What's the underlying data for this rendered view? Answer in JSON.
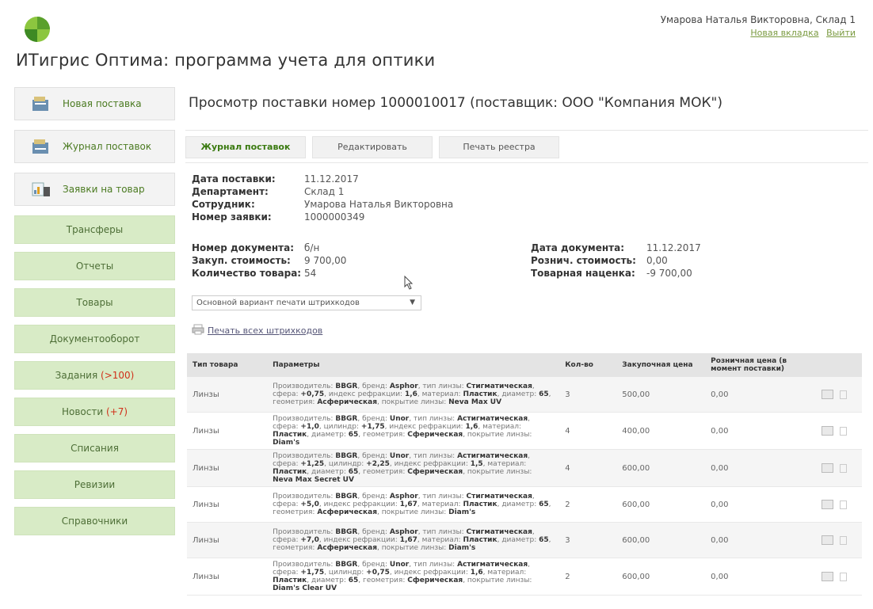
{
  "header": {
    "app_title": "ИТигрис Оптима: программа учета для оптики",
    "user_name": "Умарова Наталья Викторовна, Склад 1",
    "new_tab_link": "Новая вкладка",
    "logout_link": "Выйти"
  },
  "sidebar": {
    "items": [
      {
        "label": "Новая поставка",
        "icon": "new-delivery-icon"
      },
      {
        "label": "Журнал поставок",
        "icon": "delivery-log-icon"
      },
      {
        "label": "Заявки на товар",
        "icon": "product-requests-icon"
      },
      {
        "label": "Трансферы"
      },
      {
        "label": "Отчеты"
      },
      {
        "label": "Товары"
      },
      {
        "label": "Документооборот"
      },
      {
        "label": "Задания",
        "badge": "(>100)"
      },
      {
        "label": "Новости",
        "badge": "(+7)"
      },
      {
        "label": "Списания"
      },
      {
        "label": "Ревизии"
      },
      {
        "label": "Справочники"
      }
    ]
  },
  "main": {
    "title": "Просмотр поставки номер 1000010017 (поставщик: ООО \"Компания МОК\")",
    "tabs": [
      "Журнал поставок",
      "Редактировать",
      "Печать реестра"
    ],
    "details": [
      {
        "key": "Дата поставки:",
        "value": "11.12.2017"
      },
      {
        "key": "Департамент:",
        "value": "Склад 1"
      },
      {
        "key": "Сотрудник:",
        "value": "Умарова Наталья Викторовна"
      },
      {
        "key": "Номер заявки:",
        "value": "1000000349"
      }
    ],
    "doc_left": [
      {
        "key": "Номер документа:",
        "value": "б/н"
      },
      {
        "key": "Закуп. стоимость:",
        "value": "9 700,00"
      },
      {
        "key": "Количество товара:",
        "value": "54"
      }
    ],
    "doc_right": [
      {
        "key": "Дата документа:",
        "value": "11.12.2017"
      },
      {
        "key": "Рознич. стоимость:",
        "value": "0,00"
      },
      {
        "key": "Товарная наценка:",
        "value": "-9 700,00"
      }
    ],
    "barcode_select": "Основной вариант печати штрихкодов",
    "print_all_link": "Печать всех штрихкодов"
  },
  "table": {
    "headers": [
      "Тип товара",
      "Параметры",
      "Кол-во",
      "Закупочная цена",
      "Розничная цена (в момент поставки)"
    ],
    "rows": [
      {
        "type": "Линзы",
        "params": [
          [
            "Производитель: ",
            "BBGR"
          ],
          [
            ", бренд: ",
            "Asphor"
          ],
          [
            ", тип линзы: ",
            "Стигматическая"
          ],
          [
            ", сфера: ",
            "+0,75"
          ],
          [
            ", индекс рефракции: ",
            "1,6"
          ],
          [
            ", материал: ",
            "Пластик"
          ],
          [
            ", диаметр: ",
            "65"
          ],
          [
            ", геометрия: ",
            "Асферическая"
          ],
          [
            ", покрытие линзы: ",
            "Neva Max UV"
          ]
        ],
        "qty": "3",
        "buy": "500,00",
        "retail": "0,00"
      },
      {
        "type": "Линзы",
        "params": [
          [
            "Производитель: ",
            "BBGR"
          ],
          [
            ", бренд: ",
            "Unor"
          ],
          [
            ", тип линзы: ",
            "Астигматическая"
          ],
          [
            ", сфера: ",
            "+1,0"
          ],
          [
            ", цилиндр: ",
            "+1,75"
          ],
          [
            ", индекс рефракции: ",
            "1,6"
          ],
          [
            ", материал: ",
            "Пластик"
          ],
          [
            ", диаметр: ",
            "65"
          ],
          [
            ", геометрия: ",
            "Сферическая"
          ],
          [
            ", покрытие линзы: ",
            "Diam's"
          ]
        ],
        "qty": "4",
        "buy": "400,00",
        "retail": "0,00"
      },
      {
        "type": "Линзы",
        "params": [
          [
            "Производитель: ",
            "BBGR"
          ],
          [
            ", бренд: ",
            "Unor"
          ],
          [
            ", тип линзы: ",
            "Астигматическая"
          ],
          [
            ", сфера: ",
            "+1,25"
          ],
          [
            ", цилиндр: ",
            "+2,25"
          ],
          [
            ", индекс рефракции: ",
            "1,5"
          ],
          [
            ", материал: ",
            "Пластик"
          ],
          [
            ", диаметр: ",
            "65"
          ],
          [
            ", геометрия: ",
            "Сферическая"
          ],
          [
            ", покрытие линзы: ",
            "Neva Max Secret UV"
          ]
        ],
        "qty": "4",
        "buy": "600,00",
        "retail": "0,00"
      },
      {
        "type": "Линзы",
        "params": [
          [
            "Производитель: ",
            "BBGR"
          ],
          [
            ", бренд: ",
            "Asphor"
          ],
          [
            ", тип линзы: ",
            "Стигматическая"
          ],
          [
            ", сфера: ",
            "+5,0"
          ],
          [
            ", индекс рефракции: ",
            "1,67"
          ],
          [
            ", материал: ",
            "Пластик"
          ],
          [
            ", диаметр: ",
            "65"
          ],
          [
            ", геометрия: ",
            "Асферическая"
          ],
          [
            ", покрытие линзы: ",
            "Diam's"
          ]
        ],
        "qty": "2",
        "buy": "600,00",
        "retail": "0,00"
      },
      {
        "type": "Линзы",
        "params": [
          [
            "Производитель: ",
            "BBGR"
          ],
          [
            ", бренд: ",
            "Asphor"
          ],
          [
            ", тип линзы: ",
            "Стигматическая"
          ],
          [
            ", сфера: ",
            "+7,0"
          ],
          [
            ", индекс рефракции: ",
            "1,67"
          ],
          [
            ", материал: ",
            "Пластик"
          ],
          [
            ", диаметр: ",
            "65"
          ],
          [
            ", геометрия: ",
            "Асферическая"
          ],
          [
            ", покрытие линзы: ",
            "Diam's"
          ]
        ],
        "qty": "3",
        "buy": "600,00",
        "retail": "0,00"
      },
      {
        "type": "Линзы",
        "params": [
          [
            "Производитель: ",
            "BBGR"
          ],
          [
            ", бренд: ",
            "Unor"
          ],
          [
            ", тип линзы: ",
            "Астигматическая"
          ],
          [
            ", сфера: ",
            "+1,75"
          ],
          [
            ", цилиндр: ",
            "+0,75"
          ],
          [
            ", индекс рефракции: ",
            "1,6"
          ],
          [
            ", материал: ",
            "Пластик"
          ],
          [
            ", диаметр: ",
            "65"
          ],
          [
            ", геометрия: ",
            "Сферическая"
          ],
          [
            ", покрытие линзы: ",
            "Diam's Clear UV"
          ]
        ],
        "qty": "2",
        "buy": "600,00",
        "retail": "0,00"
      }
    ]
  },
  "colors": {
    "accent_green": "#d8ebc6",
    "link_green": "#7a9a40",
    "badge_red": "#d0301a"
  }
}
